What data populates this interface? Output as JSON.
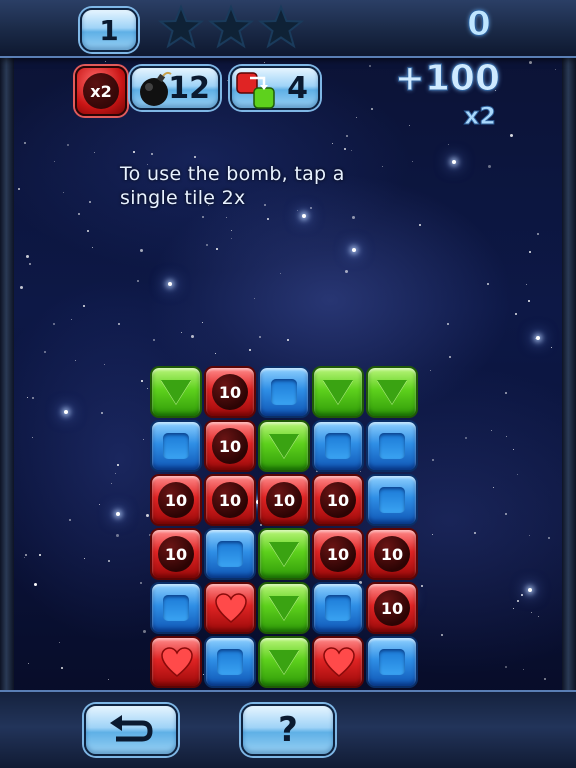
{
  "header": {
    "level": "1",
    "stars": [
      "star-empty",
      "star-empty",
      "star-empty"
    ],
    "score": "0"
  },
  "powerups": {
    "multiplier_label": "x2",
    "bomb_count": "12",
    "swap_count": "4"
  },
  "bonus": {
    "points": "+100",
    "multiplier": "x2"
  },
  "hint": {
    "line1": "To use the bomb, tap a",
    "line2": "single tile 2x"
  },
  "board": {
    "rows": [
      [
        "green",
        "red-10",
        "blue",
        "green",
        "green"
      ],
      [
        "blue",
        "red-10",
        "green",
        "blue",
        "blue"
      ],
      [
        "red-10",
        "red-10",
        "red-10",
        "red-10",
        "blue"
      ],
      [
        "red-10",
        "blue",
        "green",
        "red-10",
        "red-10"
      ],
      [
        "blue",
        "red-heart",
        "green",
        "blue",
        "red-10"
      ],
      [
        "red-heart",
        "blue",
        "green",
        "red-heart",
        "blue"
      ]
    ],
    "coin_label": "10"
  },
  "footer": {
    "back_icon": "undo-arrow-icon",
    "help_label": "?"
  },
  "colors": {
    "green": "#5ed11d",
    "blue": "#2f8fe6",
    "red": "#e02424",
    "pill": "#9fd3f7"
  }
}
